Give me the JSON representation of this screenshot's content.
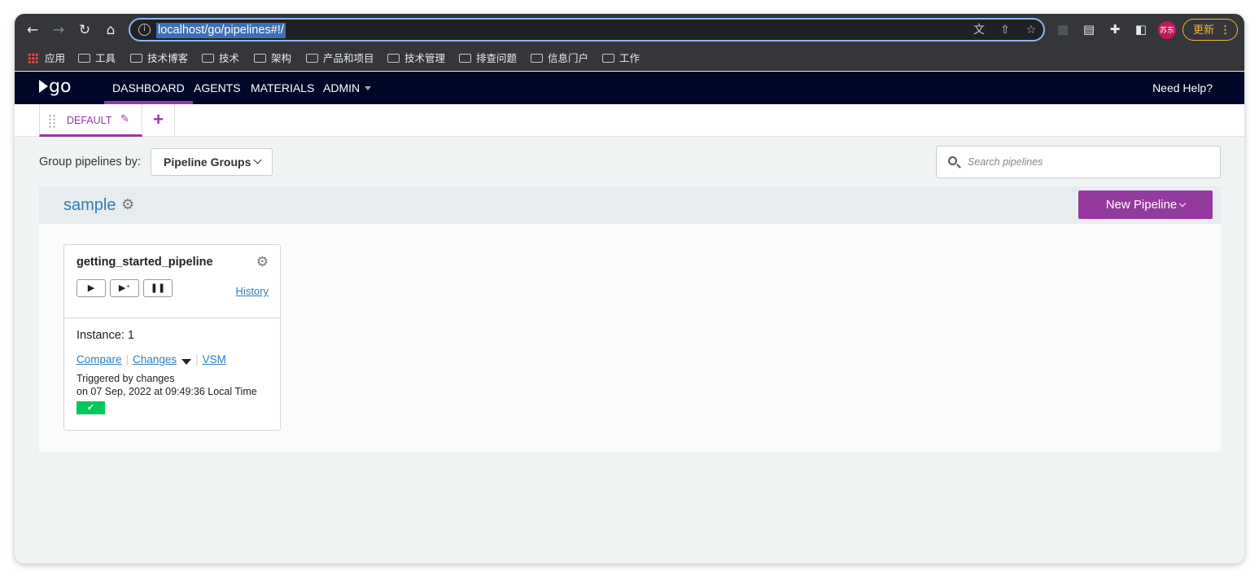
{
  "browser": {
    "url": "localhost/go/pipelines#!/",
    "profile_label": "苏东",
    "update_label": "更新",
    "bookmarks": [
      "应用",
      "工具",
      "技术博客",
      "技术",
      "架构",
      "产品和项目",
      "技术管理",
      "排查问题",
      "信息门户",
      "工作"
    ]
  },
  "header": {
    "nav": [
      "DASHBOARD",
      "AGENTS",
      "MATERIALS",
      "ADMIN"
    ],
    "active_nav": "DASHBOARD",
    "help": "Need Help?"
  },
  "tabs": {
    "default_label": "DEFAULT",
    "add_symbol": "+"
  },
  "filter": {
    "label": "Group pipelines by:",
    "selected": "Pipeline Groups",
    "search_placeholder": "Search pipelines"
  },
  "group": {
    "name": "sample",
    "new_pipeline_label": "New Pipeline",
    "pipeline": {
      "name": "getting_started_pipeline",
      "history": "History",
      "instance": "Instance: 1",
      "compare": "Compare",
      "changes": "Changes",
      "vsm": "VSM",
      "triggered_line1": "Triggered by changes",
      "triggered_line2": "on 07 Sep, 2022 at 09:49:36 Local Time",
      "status": "passed",
      "status_color": "#00c85a"
    }
  },
  "colors": {
    "accent": "#943a9e",
    "header_bg": "#000728",
    "link": "#2d7ebf"
  }
}
